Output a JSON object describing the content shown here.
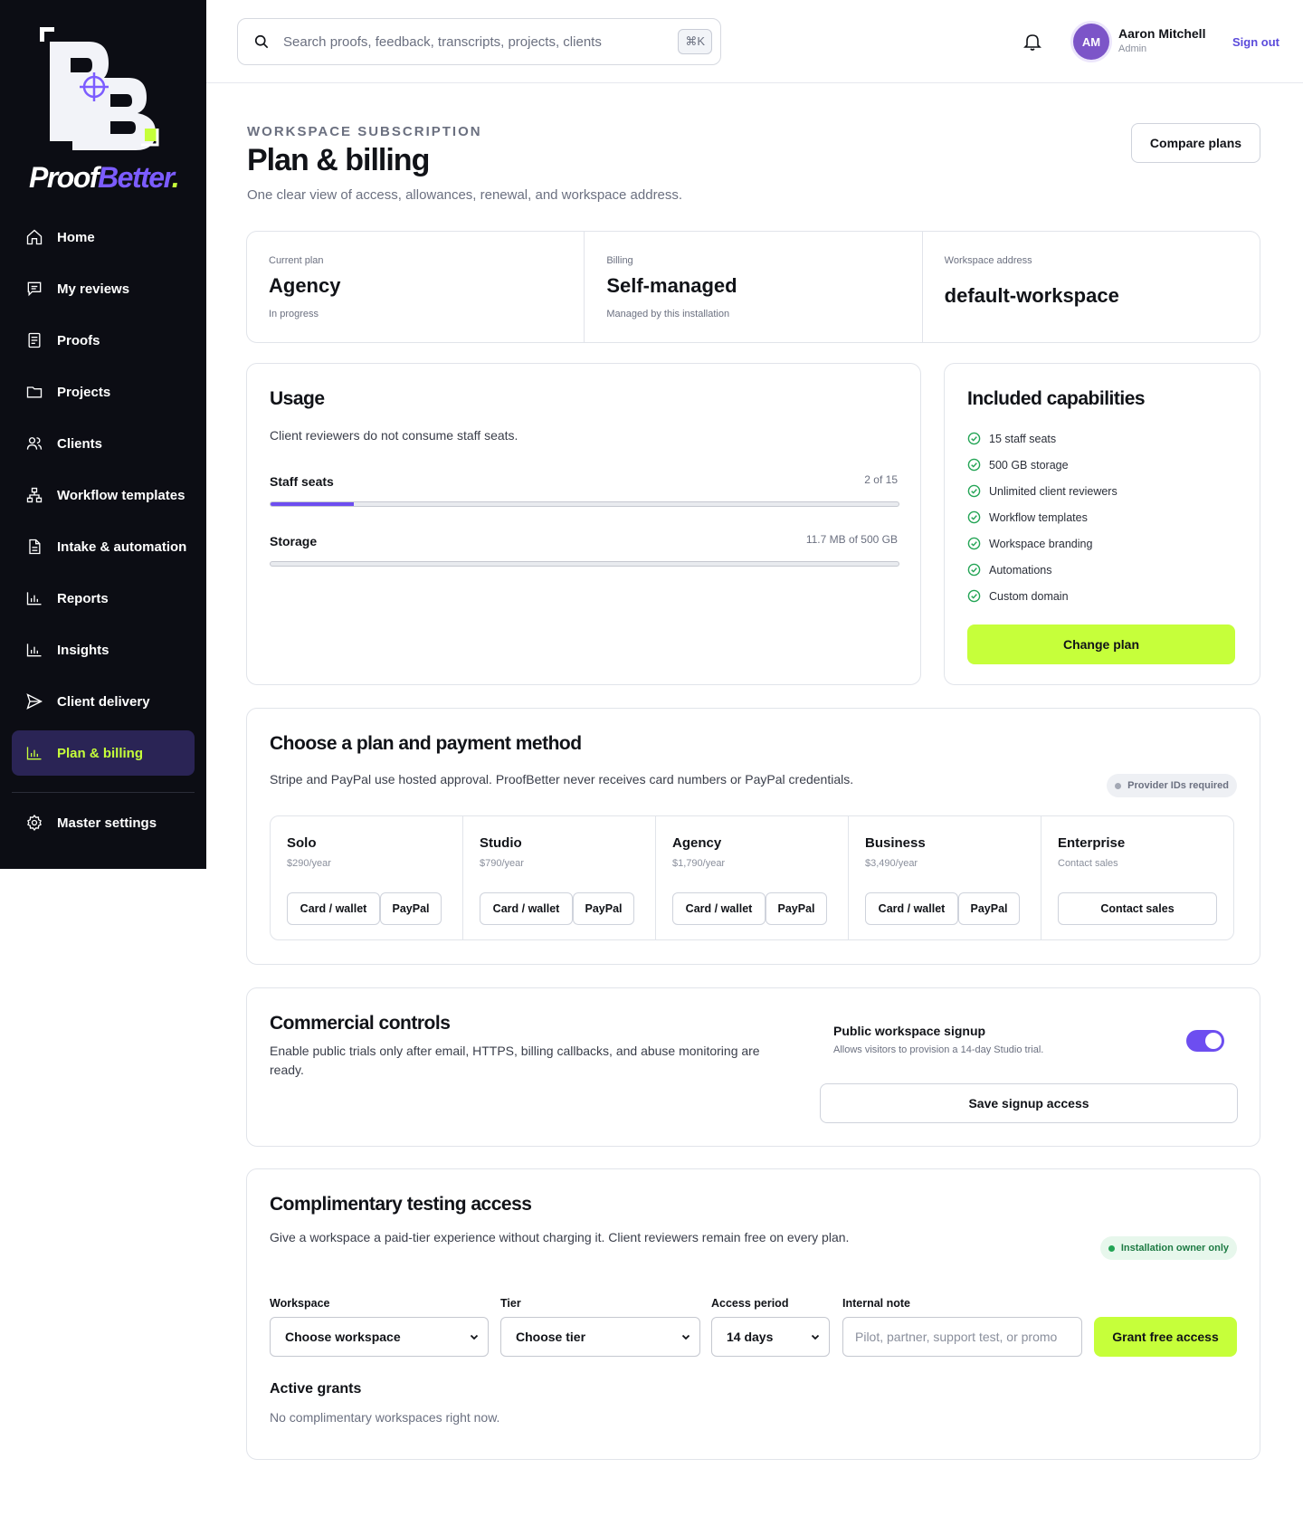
{
  "brand": {
    "name_part1": "Proof",
    "name_part2": "Better",
    "name_dot": ".",
    "accent": "#7c5cff",
    "lime": "#c6ff3a"
  },
  "sidebar": {
    "items": [
      {
        "label": "Home",
        "icon": "home-icon"
      },
      {
        "label": "My reviews",
        "icon": "chat-icon"
      },
      {
        "label": "Proofs",
        "icon": "document-icon"
      },
      {
        "label": "Projects",
        "icon": "folder-icon"
      },
      {
        "label": "Clients",
        "icon": "users-icon"
      },
      {
        "label": "Workflow templates",
        "icon": "workflow-icon"
      },
      {
        "label": "Intake & automation",
        "icon": "file-icon"
      },
      {
        "label": "Reports",
        "icon": "bar-chart-icon"
      },
      {
        "label": "Insights",
        "icon": "bar-chart-icon"
      },
      {
        "label": "Client delivery",
        "icon": "send-icon"
      },
      {
        "label": "Plan & billing",
        "icon": "bar-chart-icon",
        "active": true
      }
    ],
    "settings": {
      "label": "Master settings",
      "icon": "gear-icon"
    }
  },
  "topbar": {
    "search_placeholder": "Search proofs, feedback, transcripts, projects, clients",
    "shortcut": "⌘K",
    "user": {
      "initials": "AM",
      "name": "Aaron Mitchell",
      "role": "Admin"
    },
    "signout": "Sign out"
  },
  "header": {
    "eyebrow": "WORKSPACE SUBSCRIPTION",
    "title": "Plan & billing",
    "subtitle": "One clear view of access, allowances, renewal, and workspace address.",
    "compare_button": "Compare plans"
  },
  "summary": {
    "current_plan": {
      "label": "Current plan",
      "value": "Agency",
      "sub": "In progress"
    },
    "billing": {
      "label": "Billing",
      "value": "Self-managed",
      "sub": "Managed by this installation"
    },
    "workspace": {
      "label": "Workspace address",
      "value": "default-workspace"
    }
  },
  "usage": {
    "title": "Usage",
    "description": "Client reviewers do not consume staff seats.",
    "meters": [
      {
        "label": "Staff seats",
        "value_text": "2 of 15",
        "fraction": 0.133
      },
      {
        "label": "Storage",
        "value_text": "11.7 MB of 500 GB",
        "fraction": 0.0
      }
    ]
  },
  "capabilities": {
    "title": "Included capabilities",
    "items": [
      "15 staff seats",
      "500 GB storage",
      "Unlimited client reviewers",
      "Workflow templates",
      "Workspace branding",
      "Automations",
      "Custom domain"
    ],
    "button": "Change plan"
  },
  "choose_plan": {
    "title": "Choose a plan and payment method",
    "description": "Stripe and PayPal use hosted approval. ProofBetter never receives card numbers or PayPal credentials.",
    "badge": "Provider IDs required",
    "plans": [
      {
        "name": "Solo",
        "price": "$290/year",
        "btn1": "Card / wallet",
        "btn2": "PayPal"
      },
      {
        "name": "Studio",
        "price": "$790/year",
        "btn1": "Card / wallet",
        "btn2": "PayPal"
      },
      {
        "name": "Agency",
        "price": "$1,790/year",
        "btn1": "Card / wallet",
        "btn2": "PayPal"
      },
      {
        "name": "Business",
        "price": "$3,490/year",
        "btn1": "Card / wallet",
        "btn2": "PayPal"
      },
      {
        "name": "Enterprise",
        "price": "Contact sales",
        "btn_single": "Contact sales"
      }
    ]
  },
  "commercial": {
    "title": "Commercial controls",
    "description": "Enable public trials only after email, HTTPS, billing callbacks, and abuse monitoring are ready.",
    "toggle_label": "Public workspace signup",
    "toggle_sub": "Allows visitors to provision a 14-day Studio trial.",
    "toggle_on": true,
    "save_button": "Save signup access"
  },
  "complimentary": {
    "title": "Complimentary testing access",
    "description": "Give a workspace a paid-tier experience without charging it. Client reviewers remain free on every plan.",
    "badge": "Installation owner only",
    "fields": {
      "workspace": {
        "label": "Workspace",
        "value": "Choose workspace"
      },
      "tier": {
        "label": "Tier",
        "value": "Choose tier"
      },
      "period": {
        "label": "Access period",
        "value": "14 days"
      },
      "note": {
        "label": "Internal note",
        "placeholder": "Pilot, partner, support test, or promo"
      }
    },
    "grant_button": "Grant free access",
    "active_title": "Active grants",
    "active_empty": "No complimentary workspaces right now."
  }
}
